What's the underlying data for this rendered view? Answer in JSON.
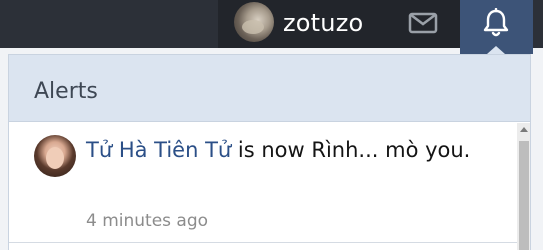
{
  "navbar": {
    "username": "zotuzo",
    "avatar_icon": "user-avatar",
    "mail_icon": "envelope-icon",
    "bell_icon": "bell-icon",
    "active_tab": "alerts"
  },
  "alerts_panel": {
    "title": "Alerts",
    "items": [
      {
        "user": "Tử Hà Tiên Tử",
        "message": "is now Rình... mò you.",
        "time": "4 minutes ago"
      }
    ]
  },
  "colors": {
    "navbar_bg": "#2c3038",
    "active_tab_bg": "#3d5478",
    "panel_header_bg": "#dbe4f0",
    "link_color": "#2b4f87",
    "time_color": "#8c8c8c"
  }
}
